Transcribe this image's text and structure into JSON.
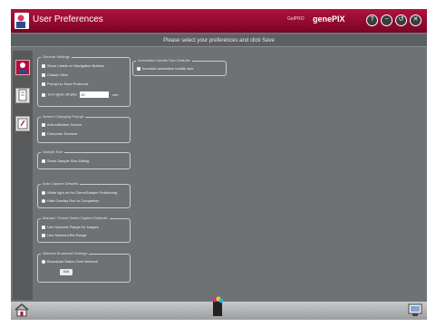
{
  "app": {
    "title": "User Preferences",
    "brand_small": "GelPRO",
    "brand_main": "genePIX"
  },
  "window_buttons": [
    "?",
    "−",
    "↺",
    "✕"
  ],
  "banner": "Please select your preferences and click Save",
  "groups": {
    "general": {
      "title": "General Settings",
      "options": [
        "Show Labels on Navigation Buttons",
        "Classic View",
        "Prompt to Save Protocols"
      ],
      "lights_label": "Turn lights off after",
      "lights_value": "10",
      "lights_unit": "min"
    },
    "screen_prompt": {
      "title": "Screen Changing Prompt",
      "options": [
        "Anti-reflective Screen",
        "Converter Screens"
      ]
    },
    "sample_size": {
      "title": "Sample Size",
      "options": [
        "Show Sample Size Dialog"
      ]
    },
    "auto_capture": {
      "title": "Auto Capture Defaults",
      "options": [
        "White light on for Chem/Sample Positioning",
        "Hide Overlay Run to Completion"
      ]
    },
    "manual_capture": {
      "title": "Manual / Chemi Series Capture Defaults",
      "options": [
        "Use Dynamic Range for Images",
        "Use Selected Bin Range"
      ]
    },
    "network": {
      "title": "Network Broadcast Settings",
      "options": [
        "Broadcast Status Over Network"
      ],
      "button": "Edit"
    },
    "annotation": {
      "title": "Annotation Handle Size Defaults",
      "options": [
        "Increase annotation handle size"
      ]
    }
  },
  "icons": {
    "home": "home-icon",
    "center": "instrument-icon",
    "right": "computer-icon"
  },
  "colors": {
    "titlebar": "#9b0a32",
    "accent": "#b10d3c",
    "panel": "#6f7274"
  }
}
